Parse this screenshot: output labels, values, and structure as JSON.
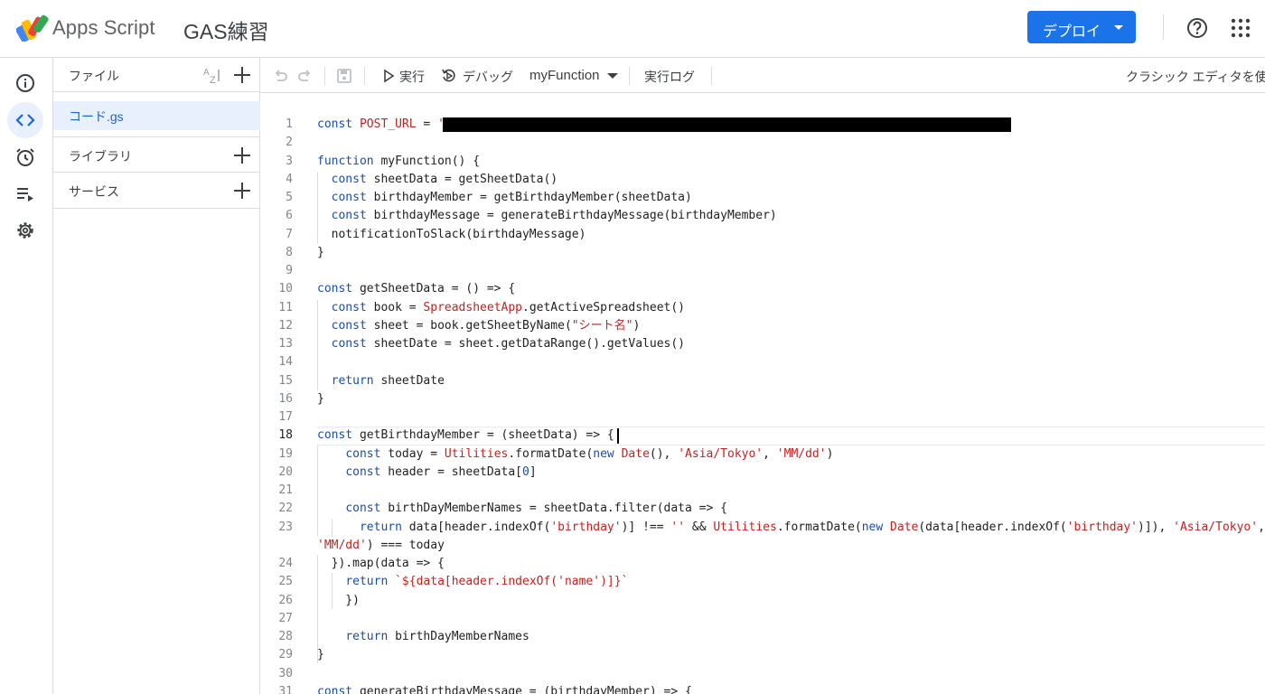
{
  "header": {
    "brand": "Apps Script",
    "project_title": "GAS練習",
    "deploy_label": "デプロイ",
    "icons": [
      "apps-script-logo",
      "help-icon",
      "apps-grid-icon"
    ]
  },
  "rail": {
    "items": [
      "overview-icon",
      "editor-icon",
      "triggers-icon",
      "executions-icon",
      "settings-icon"
    ],
    "active": "editor-icon"
  },
  "files_panel": {
    "title": "ファイル",
    "file_name": "コード.gs",
    "libraries_label": "ライブラリ",
    "services_label": "サービス"
  },
  "toolbar": {
    "run_label": "実行",
    "debug_label": "デバッグ",
    "function_name": "myFunction",
    "log_label": "実行ログ",
    "classic_label": "クラシック エディタを使"
  },
  "editor": {
    "current_line": 18,
    "line_numbers": [
      "1",
      "2",
      "3",
      "4",
      "5",
      "6",
      "7",
      "8",
      "9",
      "10",
      "11",
      "12",
      "13",
      "14",
      "15",
      "16",
      "17",
      "18",
      "19",
      "20",
      "21",
      "22",
      "23",
      "",
      "24",
      "25",
      "26",
      "27",
      "28",
      "29",
      "30",
      "31"
    ],
    "code": [
      "const POST_URL = '",
      "",
      "function myFunction() {",
      "  const sheetData = getSheetData()",
      "  const birthdayMember = getBirthdayMember(sheetData)",
      "  const birthdayMessage = generateBirthdayMessage(birthdayMember)",
      "  notificationToSlack(birthdayMessage)",
      "}",
      "",
      "const getSheetData = () => {",
      "  const book = SpreadsheetApp.getActiveSpreadsheet()",
      "  const sheet = book.getSheetByName(\"シート名\")",
      "  const sheetDate = sheet.getDataRange().getValues()",
      "",
      "  return sheetDate",
      "}",
      "",
      "const getBirthdayMember = (sheetData) => {",
      "    const today = Utilities.formatDate(new Date(), 'Asia/Tokyo', 'MM/dd')",
      "    const header = sheetData[0]",
      "",
      "    const birthDayMemberNames = sheetData.filter(data => {",
      "      return data[header.indexOf('birthday')] !== '' && Utilities.formatDate(new Date(data[header.indexOf('birthday')]), 'Asia/Tokyo',",
      "'MM/dd') === today",
      "  }).map(data => {",
      "    return `${data[header.indexOf('name')]}`",
      "    })",
      "",
      "    return birthDayMemberNames",
      "}",
      "",
      "const generateBirthdayMessage = (birthdayMember) => {"
    ]
  }
}
